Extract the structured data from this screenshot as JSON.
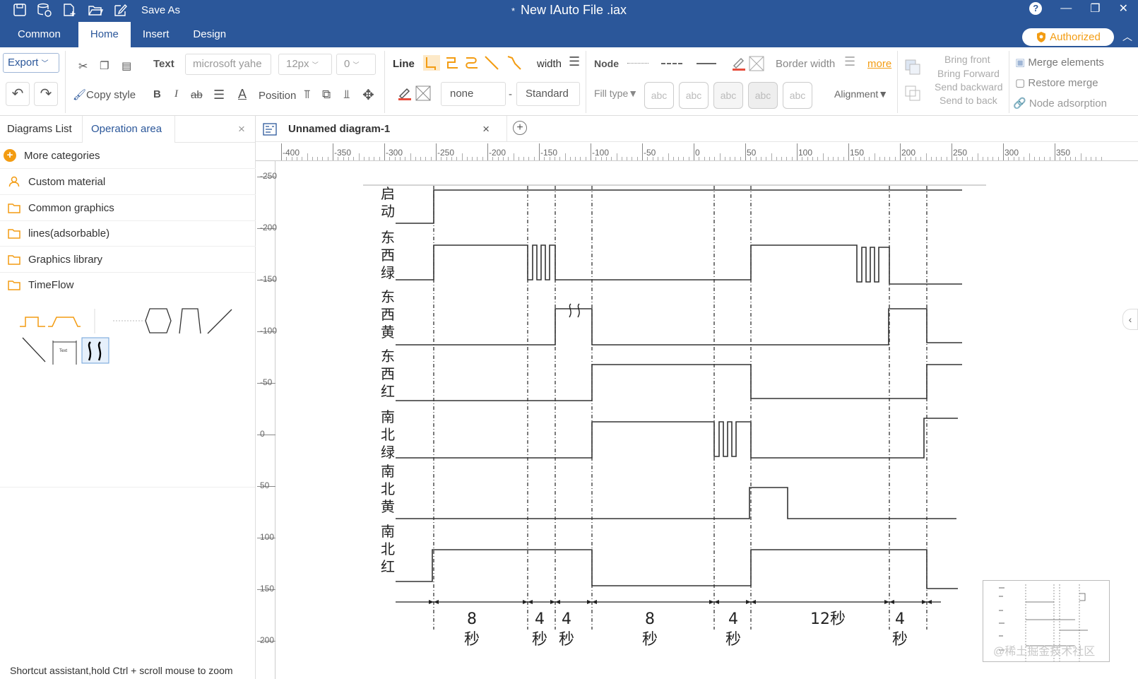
{
  "window": {
    "title": "New IAuto File .iax",
    "dirty_marker": "*",
    "save_as": "Save As",
    "help": "?",
    "minimize": "—",
    "restore": "❐",
    "close": "✕"
  },
  "menu_tabs": [
    {
      "label": "Common"
    },
    {
      "label": "Home"
    },
    {
      "label": "Insert"
    },
    {
      "label": "Design"
    }
  ],
  "authorized_badge": "Authorized",
  "collapse_ribbon": "︿",
  "ribbon": {
    "export": "Export",
    "text_label": "Text",
    "font_family": "microsoft yahe",
    "font_size": "12px",
    "spacing": "0",
    "copy_style": "Copy style",
    "bold": "B",
    "italic": "I",
    "strike": "ab",
    "font_color": "A",
    "position": "Position",
    "line_label": "Line",
    "width_label": "width",
    "line_fill": "none",
    "dash": "-",
    "line_style": "Standard",
    "node_label": "Node",
    "border_width": "Border width",
    "more": "more",
    "fill_type": "Fill type▼",
    "abc": [
      "abc",
      "abc",
      "abc",
      "abc",
      "abc"
    ],
    "alignment": "Alignment▼",
    "bring_front": "Bring front",
    "bring_forward": "Bring Forward",
    "send_backward": "Send backward",
    "send_to_back": "Send to back",
    "merge_elements": "Merge elements",
    "restore_merge": "Restore merge",
    "node_adsorption": "Node adsorption"
  },
  "left_panel": {
    "tab_diagrams": "Diagrams List",
    "tab_operation": "Operation area",
    "close": "×",
    "categories": [
      {
        "label": "More categories",
        "icon": "plus-circle-icon"
      },
      {
        "label": "Custom material",
        "icon": "person-icon"
      },
      {
        "label": "Common graphics",
        "icon": "folder-icon"
      },
      {
        "label": "lines(adsorbable)",
        "icon": "folder-icon"
      },
      {
        "label": "Graphics library",
        "icon": "folder-icon"
      },
      {
        "label": "TimeFlow",
        "icon": "folder-icon"
      }
    ],
    "shape_text": "Text",
    "shortcut": "Shortcut assistant,hold Ctrl + scroll mouse to zoom"
  },
  "doc_tab": {
    "name": "Unnamed diagram-1",
    "close": "×",
    "add": "+"
  },
  "ruler": {
    "h": [
      "-400",
      "-350",
      "-300",
      "-250",
      "-200",
      "-150",
      "-100",
      "-50",
      "0",
      "50",
      "100",
      "150",
      "200",
      "250",
      "300",
      "350"
    ],
    "v": [
      "-250",
      "-200",
      "-150",
      "-100",
      "-50",
      "0",
      "50",
      "100",
      "150",
      "200"
    ]
  },
  "timing": {
    "signals": [
      [
        "启",
        "动"
      ],
      [
        "东",
        "西",
        "绿"
      ],
      [
        "东",
        "西",
        "黄"
      ],
      [
        "东",
        "西",
        "红"
      ],
      [
        "南",
        "北",
        "绿"
      ],
      [
        "南",
        "北",
        "黄"
      ],
      [
        "南",
        "北",
        "红"
      ]
    ],
    "durations": [
      [
        "8",
        "秒"
      ],
      [
        "4",
        "秒"
      ],
      [
        "4",
        "秒"
      ],
      [
        "8",
        "秒"
      ],
      [
        "4",
        "秒"
      ],
      [
        "12秒"
      ],
      [
        "4",
        "秒"
      ]
    ]
  },
  "side_toggle": "‹",
  "watermark": "@稀土掘金技术社区"
}
